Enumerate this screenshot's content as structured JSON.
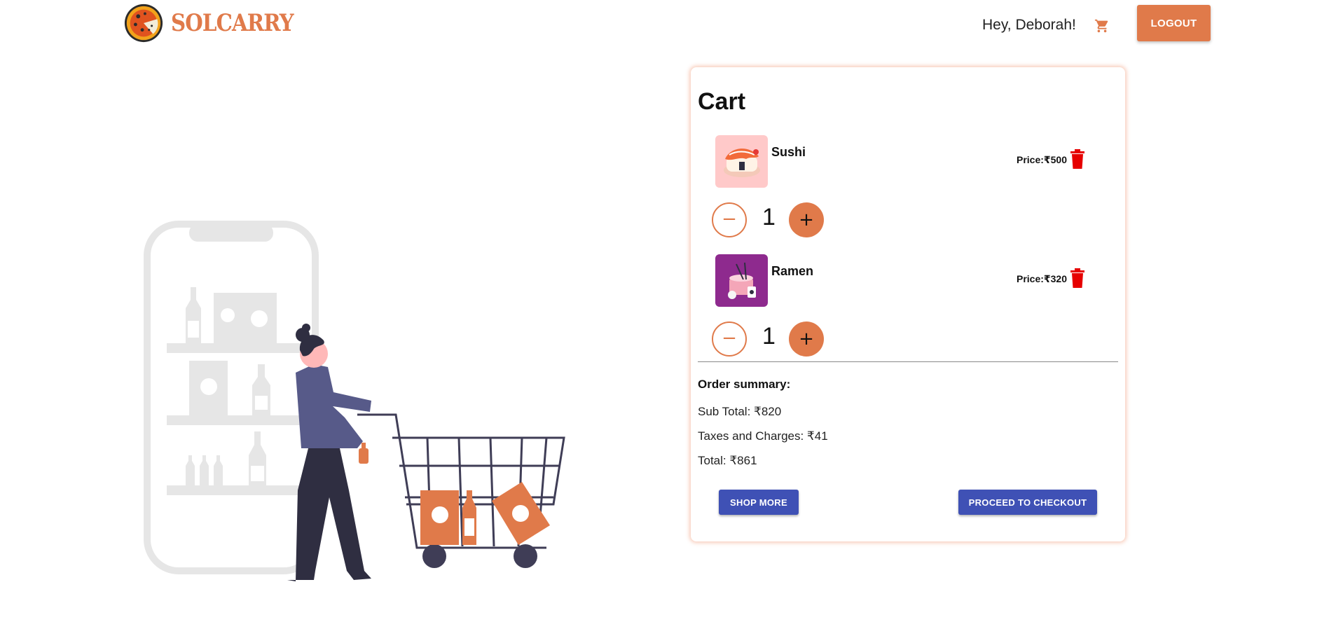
{
  "header": {
    "brand": "SOLCARRY",
    "greeting": "Hey,  Deborah!",
    "logout_label": "LOGOUT"
  },
  "cart": {
    "title": "Cart",
    "items": [
      {
        "name": "Sushi",
        "price": "Price:₹500",
        "quantity": "1",
        "minus": "−",
        "plus": "+"
      },
      {
        "name": "Ramen",
        "price": "Price:₹320",
        "quantity": "1",
        "minus": "−",
        "plus": "+"
      }
    ],
    "summary": {
      "title": "Order summary:",
      "subtotal": "Sub Total: ₹820",
      "taxes": "Taxes and Charges: ₹41",
      "total": "Total: ₹861"
    },
    "shop_more_label": "SHOP MORE",
    "checkout_label": "PROCEED TO CHECKOUT"
  },
  "colors": {
    "accent": "#e07a4a",
    "primary_button": "#3f51b5",
    "trash": "#e60000"
  },
  "icons": [
    "pizza-logo-icon",
    "shopping-cart-icon",
    "trash-icon",
    "minus-icon",
    "plus-icon"
  ]
}
